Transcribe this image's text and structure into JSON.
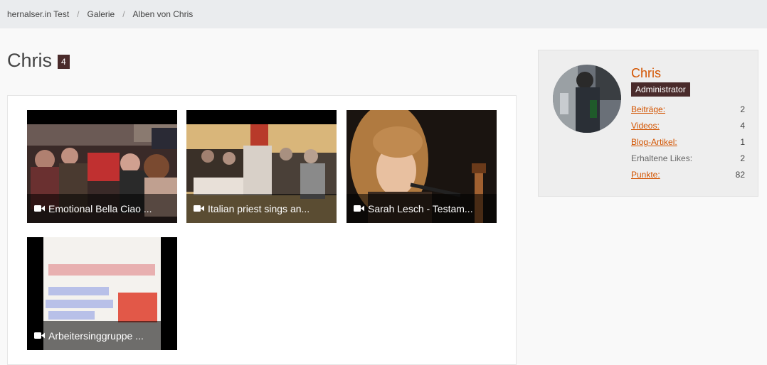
{
  "breadcrumb": [
    {
      "label": "hernalser.in Test"
    },
    {
      "label": "Galerie"
    },
    {
      "label": "Alben von Chris"
    }
  ],
  "page": {
    "title": "Chris",
    "count": "4"
  },
  "videos": [
    {
      "title": "Emotional Bella Ciao ...",
      "icon": "video-camera-icon"
    },
    {
      "title": "Italian priest sings an...",
      "icon": "video-camera-icon"
    },
    {
      "title": "Sarah Lesch - Testam...",
      "icon": "video-camera-icon"
    },
    {
      "title": "Arbeitersinggruppe ...",
      "icon": "video-camera-icon"
    }
  ],
  "profile": {
    "name": "Chris",
    "role": "Administrator",
    "stats": [
      {
        "label": "Beiträge:",
        "value": "2"
      },
      {
        "label": "Videos:",
        "value": "4"
      },
      {
        "label": "Blog-Artikel:",
        "value": "1"
      },
      {
        "label": "Erhaltene Likes:",
        "value": "2"
      },
      {
        "label": "Punkte:",
        "value": "82"
      }
    ]
  },
  "colors": {
    "accent": "#d35400",
    "badge": "#4a2b2b",
    "breadcrumb_bg": "#eaecee"
  }
}
